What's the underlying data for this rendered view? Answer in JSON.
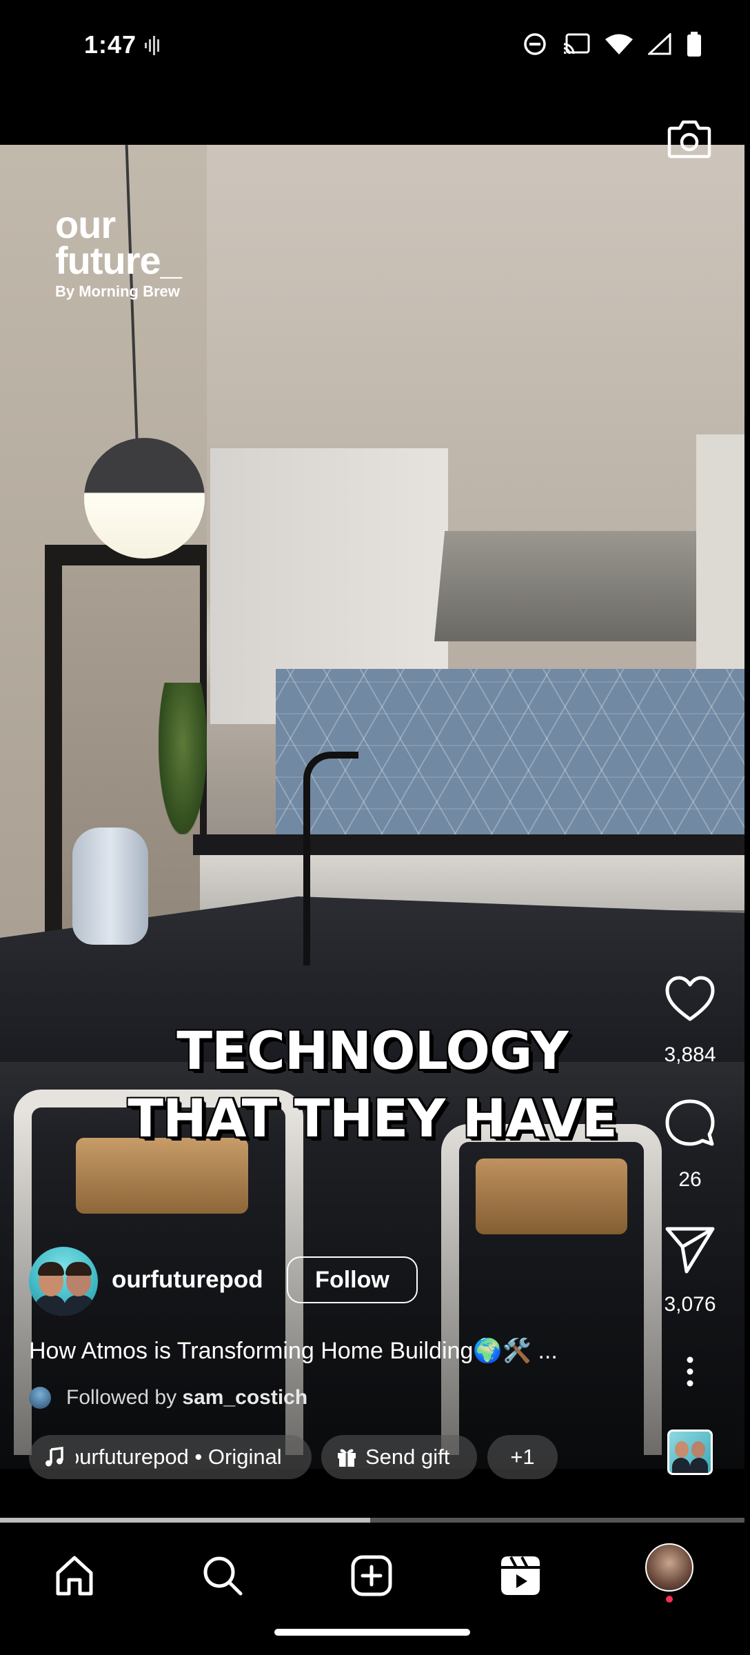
{
  "status_bar": {
    "time": "1:47",
    "icons": [
      "vibrate-icon",
      "do-not-disturb-icon",
      "cast-icon",
      "wifi-icon",
      "signal-icon",
      "battery-icon"
    ]
  },
  "video": {
    "brand_line1": "our",
    "brand_line2": "future_",
    "brand_sub": "By Morning Brew",
    "caption_line1": "TECHNOLOGY",
    "caption_line2": "THAT THEY HAVE",
    "progress": 0.497
  },
  "actions": {
    "likes": "3,884",
    "comments": "26",
    "shares": "3,076"
  },
  "post": {
    "username": "ourfuturepod",
    "follow_label": "Follow",
    "description": "How Atmos is Transforming Home Building🌍🛠️ ...",
    "followed_by_prefix": "Followed by ",
    "followed_by_user": "sam_costich",
    "audio_label": "ourfuturepod • Original audio",
    "gift_label": "Send gift",
    "more_label": "+1"
  },
  "colors": {
    "background": "#000000",
    "text": "#ffffff",
    "notification_dot": "#ff2d55"
  },
  "nav": {
    "items": [
      "home-icon",
      "search-icon",
      "create-icon",
      "reels-icon",
      "profile-avatar"
    ]
  }
}
